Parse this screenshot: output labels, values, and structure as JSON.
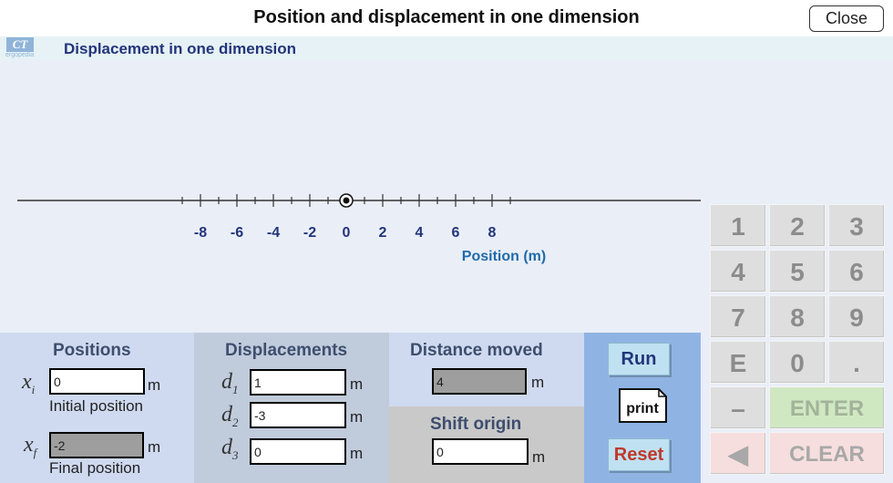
{
  "window": {
    "title": "Position and displacement in one dimension",
    "close_label": "Close"
  },
  "header": {
    "logo_mark": "CT",
    "logo_sub": "ergopedia",
    "app_title": "Displacement in one dimension"
  },
  "chart_data": {
    "type": "number-line",
    "xlabel": "Position (m)",
    "xlim": [
      -9.5,
      9.75
    ],
    "tick_labels": [
      -8,
      -6,
      -4,
      -2,
      0,
      2,
      4,
      6,
      8
    ],
    "minor_tick_step": 1,
    "marker_position": 0
  },
  "keypad": {
    "keys": [
      [
        "1",
        "2",
        "3"
      ],
      [
        "4",
        "5",
        "6"
      ],
      [
        "7",
        "8",
        "9"
      ],
      [
        "E",
        "0",
        "."
      ]
    ],
    "minus": "–",
    "enter": "ENTER",
    "back": "◀",
    "clear": "CLEAR"
  },
  "positions": {
    "title": "Positions",
    "xi_var": "x",
    "xi_sub": "i",
    "xi_value": "0",
    "xi_caption": "Initial position",
    "xf_var": "x",
    "xf_sub": "f",
    "xf_value": "-2",
    "xf_caption": "Final position",
    "unit": "m"
  },
  "displacements": {
    "title": "Displacements",
    "items": [
      {
        "var": "d",
        "sub": "1",
        "value": "1"
      },
      {
        "var": "d",
        "sub": "2",
        "value": "-3"
      },
      {
        "var": "d",
        "sub": "3",
        "value": "0"
      }
    ],
    "unit": "m"
  },
  "distance": {
    "title": "Distance moved",
    "value": "4",
    "unit": "m"
  },
  "shift": {
    "title": "Shift origin",
    "value": "0",
    "unit": "m"
  },
  "controls": {
    "run": "Run",
    "print": "print",
    "reset": "Reset"
  },
  "colors": {
    "axis_label": "#23357a",
    "axis_title": "#1f6aa8",
    "plot_bg": "#eaeef7",
    "run_panel": "#8fb4e3"
  }
}
